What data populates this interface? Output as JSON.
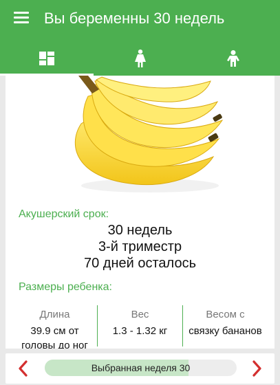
{
  "colors": {
    "primary": "#4caf50",
    "accent_red": "#d32f2f",
    "progress_fill": "#c7e6c7"
  },
  "app": {
    "title": "Вы беременны 30 недель"
  },
  "tabs": [
    {
      "icon": "dashboard-icon",
      "active": true
    },
    {
      "icon": "pregnant-woman-icon",
      "active": false
    },
    {
      "icon": "child-icon",
      "active": false
    }
  ],
  "hero": {
    "icon": "banana-image"
  },
  "term": {
    "label": "Акушерский срок:",
    "weeks": "30 недель",
    "trimester": "3-й триместр",
    "remaining": "70 дней осталось"
  },
  "size": {
    "label": "Размеры ребенка:",
    "columns": [
      {
        "title": "Длина",
        "value_line1": "39.9 см от",
        "value_line2": "головы до ног"
      },
      {
        "title": "Вес",
        "value_line1": "1.3 - 1.32 кг",
        "value_line2": ""
      },
      {
        "title": "Весом с",
        "value_line1": "связку бананов",
        "value_line2": ""
      }
    ]
  },
  "week_selector": {
    "label": "Выбранная неделя 30",
    "progress": 0.75
  }
}
